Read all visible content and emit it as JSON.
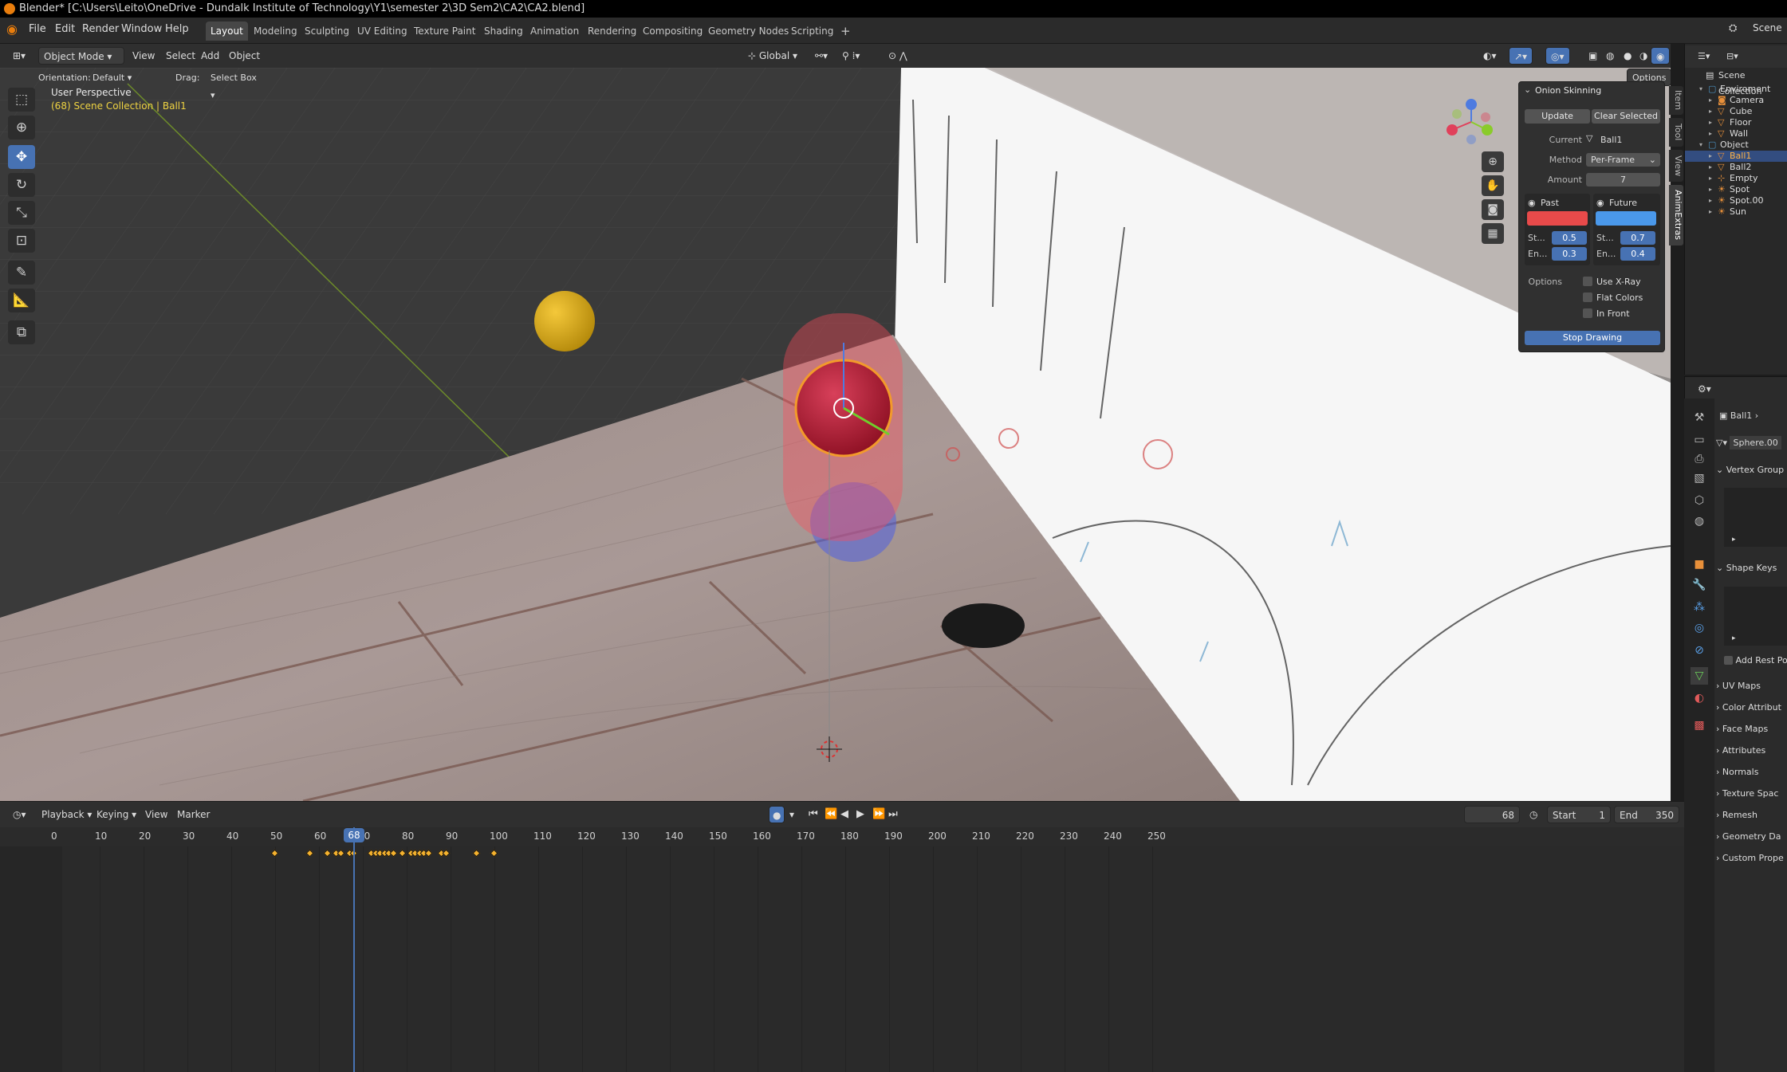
{
  "window": {
    "title": "Blender* [C:\\Users\\Leito\\OneDrive - Dundalk Institute of Technology\\Y1\\semester 2\\3D Sem2\\CA2\\CA2.blend]"
  },
  "menu": {
    "items": [
      "File",
      "Edit",
      "Render",
      "Window",
      "Help"
    ]
  },
  "workspaces": {
    "tabs": [
      "Layout",
      "Modeling",
      "Sculpting",
      "UV Editing",
      "Texture Paint",
      "Shading",
      "Animation",
      "Rendering",
      "Compositing",
      "Geometry Nodes",
      "Scripting"
    ],
    "add": "+",
    "active": "Layout"
  },
  "scene": {
    "label": "Scene"
  },
  "viewport_header": {
    "mode": "Object Mode",
    "view": "View",
    "select": "Select",
    "add": "Add",
    "object": "Object",
    "transform": "Global",
    "options": "Options"
  },
  "tool_settings": {
    "orientation_label": "Orientation:",
    "orientation_value": "Default",
    "drag_label": "Drag:",
    "drag_value": "Select Box"
  },
  "viewport": {
    "perspective": "User Perspective",
    "collection_info": "(68) Scene Collection | Ball1"
  },
  "sidebar_tabs": [
    "Item",
    "Tool",
    "View",
    "AnimExtras"
  ],
  "onion_panel": {
    "title": "Onion Skinning",
    "update": "Update",
    "clear_selected": "Clear Selected",
    "current_label": "Current",
    "current_value": "Ball1",
    "method_label": "Method",
    "method_value": "Per-Frame",
    "amount_label": "Amount",
    "amount_value": "7",
    "past": {
      "label": "Past",
      "color": "#e84a4a",
      "start_label": "St...",
      "start_value": "0.5",
      "end_label": "En...",
      "end_value": "0.3"
    },
    "future": {
      "label": "Future",
      "color": "#4a98ea",
      "start_label": "St...",
      "start_value": "0.7",
      "end_label": "En...",
      "end_value": "0.4"
    },
    "options_label": "Options",
    "xray": "Use X-Ray",
    "flat_colors": "Flat Colors",
    "in_front": "In Front",
    "stop_drawing": "Stop Drawing"
  },
  "timeline": {
    "playback": "Playback",
    "keying": "Keying",
    "view": "View",
    "marker": "Marker",
    "current_frame": "68",
    "start_label": "Start",
    "start_value": "1",
    "end_label": "End",
    "end_value": "350",
    "ruler_labels": [
      "0",
      "10",
      "20",
      "30",
      "40",
      "50",
      "60",
      "70",
      "80",
      "90",
      "100",
      "110",
      "120",
      "130",
      "140",
      "150",
      "160",
      "170",
      "180",
      "190",
      "200",
      "210",
      "220",
      "230",
      "240",
      "250"
    ],
    "keyframes": [
      50,
      58,
      62,
      64,
      65,
      67,
      68,
      72,
      73,
      74,
      75,
      76,
      77,
      79,
      81,
      82,
      83,
      84,
      85,
      88,
      89,
      96,
      100
    ]
  },
  "outliner": {
    "root": "Scene Collection",
    "items": [
      {
        "label": "Enviroment",
        "depth": 1,
        "kind": "collection"
      },
      {
        "label": "Camera",
        "depth": 2,
        "kind": "camera"
      },
      {
        "label": "Cube",
        "depth": 2,
        "kind": "mesh"
      },
      {
        "label": "Floor",
        "depth": 2,
        "kind": "mesh"
      },
      {
        "label": "Wall",
        "depth": 2,
        "kind": "mesh"
      },
      {
        "label": "Object",
        "depth": 1,
        "kind": "collection"
      },
      {
        "label": "Ball1",
        "depth": 2,
        "kind": "mesh",
        "selected": true
      },
      {
        "label": "Ball2",
        "depth": 2,
        "kind": "mesh"
      },
      {
        "label": "Empty",
        "depth": 2,
        "kind": "empty"
      },
      {
        "label": "Spot",
        "depth": 2,
        "kind": "light"
      },
      {
        "label": "Spot.00",
        "depth": 2,
        "kind": "light"
      },
      {
        "label": "Sun",
        "depth": 2,
        "kind": "light"
      }
    ]
  },
  "properties": {
    "object_name": "Ball1",
    "mesh_name": "Sphere.00",
    "sections": [
      "Vertex Group",
      "Shape Keys",
      "UV Maps",
      "Color Attribut",
      "Face Maps",
      "Attributes",
      "Normals",
      "Texture Spac",
      "Remesh",
      "Geometry Da",
      "Custom Prope"
    ],
    "add_rest_pos": "Add Rest Pos"
  }
}
